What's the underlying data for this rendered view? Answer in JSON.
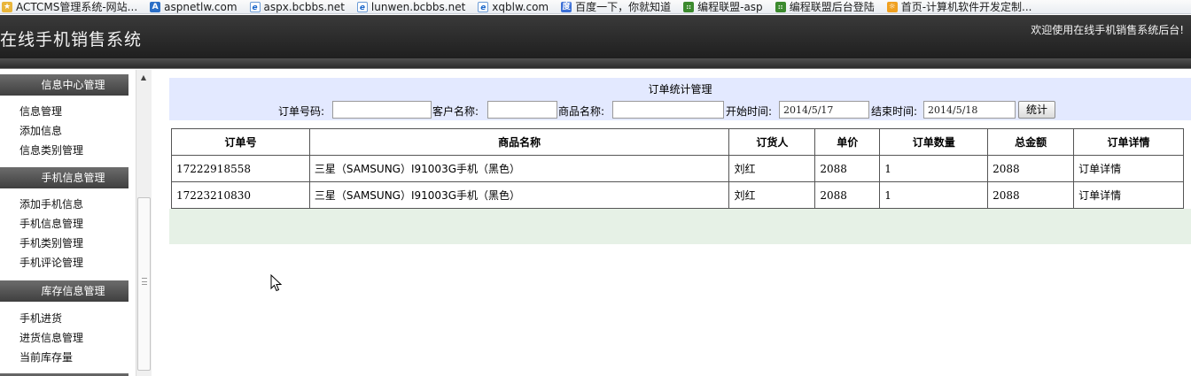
{
  "favorites": [
    {
      "icon": "star-icon",
      "label": "ACTCMS管理系统-网站..."
    },
    {
      "icon": "asp-icon",
      "label": "aspnetlw.com"
    },
    {
      "icon": "ie-icon",
      "label": "aspx.bcbbs.net"
    },
    {
      "icon": "ie-icon",
      "label": "lunwen.bcbbs.net"
    },
    {
      "icon": "ie-icon",
      "label": "xqblw.com"
    },
    {
      "icon": "baidu-icon",
      "label": "百度一下，你就知道"
    },
    {
      "icon": "bc-icon",
      "label": "编程联盟-asp"
    },
    {
      "icon": "bc-icon",
      "label": "编程联盟后台登陆"
    },
    {
      "icon": "sun-icon",
      "label": "首页-计算机软件开发定制..."
    }
  ],
  "header": {
    "title": "在线手机销售系统",
    "welcome": "欢迎使用在线手机销售系统后台!"
  },
  "sidebar": {
    "sections": [
      {
        "title": "信息中心管理",
        "items": [
          "信息管理",
          "添加信息",
          "信息类别管理"
        ]
      },
      {
        "title": "手机信息管理",
        "items": [
          "添加手机信息",
          "手机信息管理",
          "手机类别管理",
          "手机评论管理"
        ]
      },
      {
        "title": "库存信息管理",
        "items": [
          "手机进货",
          "进货信息管理",
          "当前库存量"
        ]
      }
    ]
  },
  "search": {
    "title": "订单统计管理",
    "order_no_label": "订单号码:",
    "customer_label": "客户名称:",
    "product_label": "商品名称:",
    "start_label": "开始时间:",
    "start_value": "2014/5/17",
    "end_label": "结束时间:",
    "end_value": "2014/5/18",
    "button": "统计"
  },
  "table": {
    "headers": [
      "订单号",
      "商品名称",
      "订货人",
      "单价",
      "订单数量",
      "总金额",
      "订单详情"
    ],
    "rows": [
      [
        "17222918558",
        "三星（SAMSUNG）I91003G手机（黑色）",
        "刘红",
        "2088",
        "1",
        "2088",
        "订单详情"
      ],
      [
        "17223210830",
        "三星（SAMSUNG）I91003G手机（黑色）",
        "刘红",
        "2088",
        "1",
        "2088",
        "订单详情"
      ]
    ]
  },
  "colors": {
    "header_bg": "#2a2a2a",
    "search_panel_bg": "#e3e9ff",
    "footer_band_bg": "#e6f1e6",
    "section_head_bg": "#555555"
  }
}
